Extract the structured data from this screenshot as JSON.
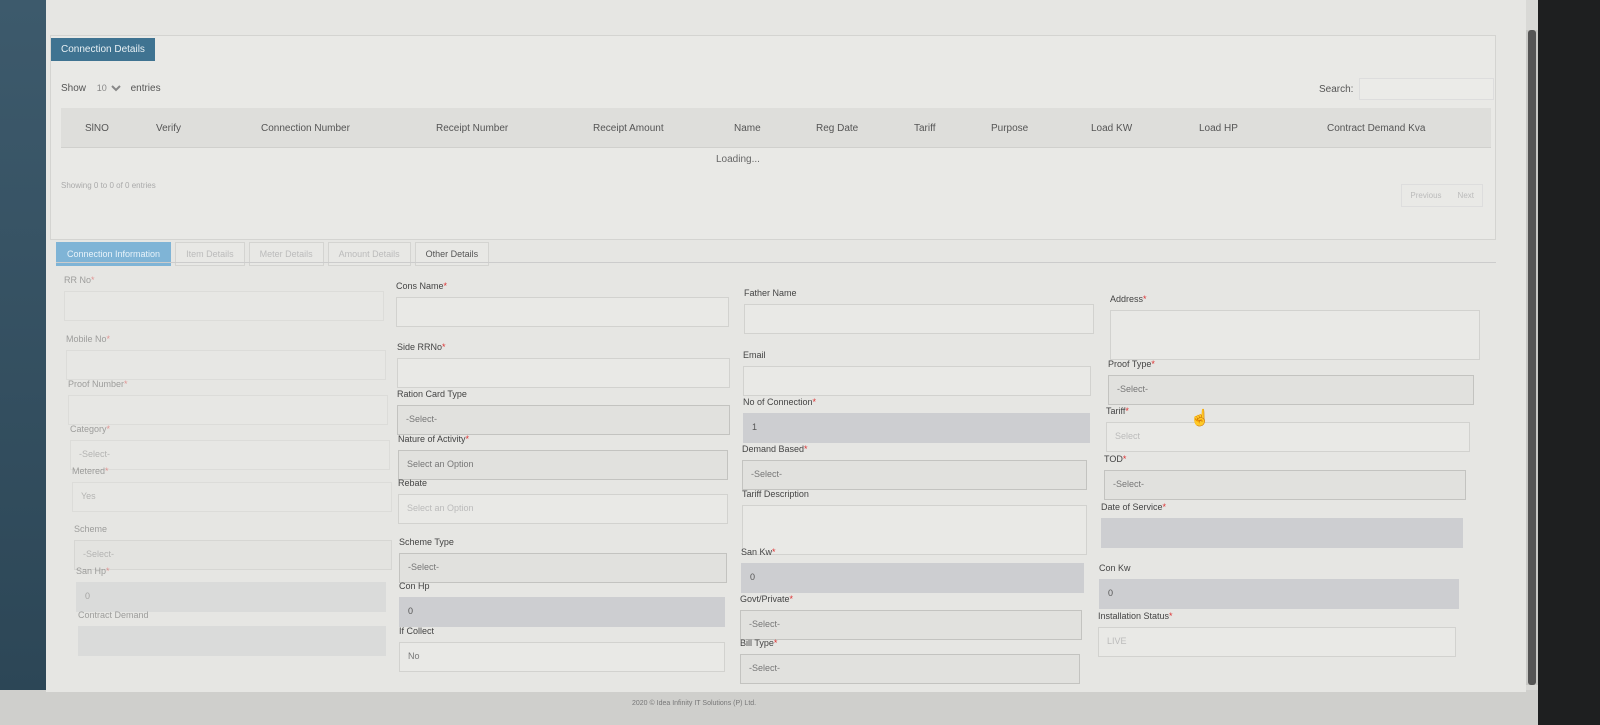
{
  "section_title": "Connection Details",
  "table_controls": {
    "show_label": "Show",
    "entries_value": "10",
    "entries_label": "entries",
    "search_label": "Search:"
  },
  "columns": [
    "SlNO",
    "Verify",
    "Connection Number",
    "Receipt Number",
    "Receipt Amount",
    "Name",
    "Reg Date",
    "Tariff",
    "Purpose",
    "Load KW",
    "Load HP",
    "Contract Demand Kva"
  ],
  "loading_text": "Loading...",
  "info_text": "Showing 0 to 0 of 0 entries",
  "pager": {
    "previous": "Previous",
    "next": "Next"
  },
  "tabs": [
    "Connection Information",
    "Item Details",
    "Meter Details",
    "Amount Details",
    "Other Details"
  ],
  "fields": {
    "col1": [
      {
        "label": "RR No",
        "req": "*",
        "value": ""
      },
      {
        "label": "Mobile No",
        "req": "*",
        "value": ""
      },
      {
        "label": "Proof Number",
        "req": "*",
        "value": ""
      },
      {
        "label": "Category",
        "req": "*",
        "value": "-Select-"
      },
      {
        "label": "Metered",
        "req": "*",
        "value": "Yes"
      },
      {
        "label": "Scheme",
        "req": "",
        "value": "-Select-"
      },
      {
        "label": "San Hp",
        "req": "*",
        "value": "0"
      },
      {
        "label": "Contract Demand",
        "req": "",
        "value": ""
      }
    ],
    "col2": [
      {
        "label": "Cons Name",
        "req": "*",
        "value": ""
      },
      {
        "label": "Side RRNo",
        "req": "*",
        "value": ""
      },
      {
        "label": "Ration Card Type",
        "req": "",
        "value": "-Select-"
      },
      {
        "label": "Nature of Activity",
        "req": "*",
        "value": "Select an Option"
      },
      {
        "label": "Rebate",
        "req": "",
        "value": "Select an Option"
      },
      {
        "label": "Scheme Type",
        "req": "",
        "value": "-Select-"
      },
      {
        "label": "Con Hp",
        "req": "",
        "value": "0"
      },
      {
        "label": "If Collect",
        "req": "",
        "value": "No"
      }
    ],
    "col3": [
      {
        "label": "Father Name",
        "req": "",
        "value": ""
      },
      {
        "label": "Email",
        "req": "",
        "value": ""
      },
      {
        "label": "No of Connection",
        "req": "*",
        "value": "1"
      },
      {
        "label": "Demand Based",
        "req": "*",
        "value": "-Select-"
      },
      {
        "label": "Tariff Description",
        "req": "",
        "value": ""
      },
      {
        "label": "San Kw",
        "req": "*",
        "value": "0"
      },
      {
        "label": "Govt/Private",
        "req": "*",
        "value": "-Select-"
      },
      {
        "label": "Bill Type",
        "req": "*",
        "value": "-Select-"
      }
    ],
    "col4": [
      {
        "label": "Address",
        "req": "*",
        "value": ""
      },
      {
        "label": "Proof Type",
        "req": "*",
        "value": "-Select-"
      },
      {
        "label": "Tariff",
        "req": "*",
        "value": "Select"
      },
      {
        "label": "TOD",
        "req": "*",
        "value": "-Select-"
      },
      {
        "label": "Date of Service",
        "req": "*",
        "value": ""
      },
      {
        "label": "Con Kw",
        "req": "",
        "value": "0"
      },
      {
        "label": "Installation Status",
        "req": "*",
        "value": "LIVE"
      }
    ]
  },
  "footer": "2020 © Idea Infinity IT Solutions (P) Ltd."
}
